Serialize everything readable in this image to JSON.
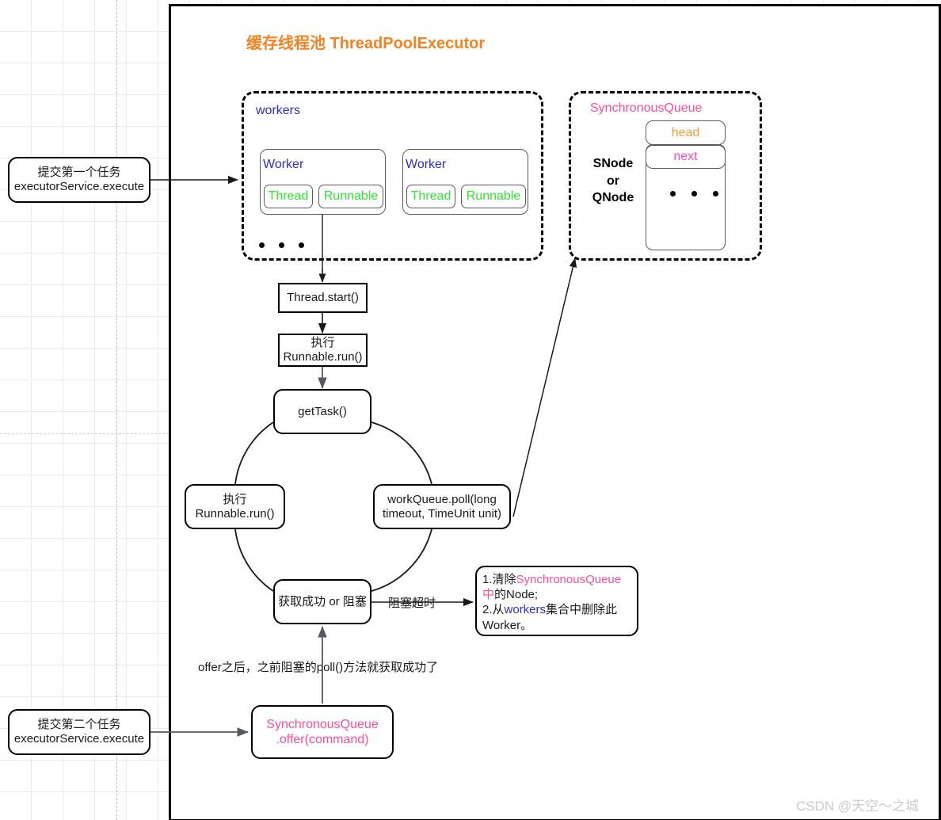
{
  "title": "缓存线程池 ThreadPoolExecutor",
  "colors": {
    "title_orange": "#f58220",
    "blue": "#2b2bd6",
    "green": "#31e531",
    "pink": "#ff4d94",
    "magenta": "#ff44cc",
    "orange": "#ff9a3c",
    "black": "#000000",
    "grid": "#e9ecef",
    "watermark": "#c9cbcd"
  },
  "workers_group": {
    "label": "workers",
    "worker_a": {
      "label": "Worker",
      "thread": "Thread",
      "runnable": "Runnable"
    },
    "worker_b": {
      "label": "Worker",
      "thread": "Thread",
      "runnable": "Runnable"
    },
    "ellipsis": "• • •"
  },
  "queue_group": {
    "label": "SynchronousQueue",
    "node_kind": "SNode\nor\nQNode",
    "node_kind_lines": [
      "SNode",
      "or",
      "QNode"
    ],
    "head": "head",
    "next": "next",
    "ellipsis": "• • •"
  },
  "inputs": {
    "first": {
      "line1": "提交第一个任务",
      "line2": "executorService.execute"
    },
    "second": {
      "line1": "提交第二个任务",
      "line2": "executorService.execute"
    }
  },
  "flow": {
    "thread_start": "Thread.start()",
    "run_top": {
      "line1": "执行",
      "line2": "Runnable.run()"
    },
    "get_task": "getTask()",
    "run_left": {
      "line1": "执行",
      "line2": "Runnable.run()"
    },
    "work_queue_poll": {
      "line1": "workQueue.poll(long",
      "line2": "timeout, TimeUnit unit)"
    },
    "acquire_or_block": "获取成功 or 阻塞",
    "timeout_label": "阻塞超时",
    "offer_note": "offer之后，之前阻塞的poll()方法就获取成功了",
    "offer_box": {
      "line1": "SynchronousQueue",
      "line2": ".offer(command)"
    }
  },
  "cleanup_note": {
    "item1_prefix": "1.清除",
    "item1_highlight": "SynchronousQueue中",
    "item1_suffix": "的Node;",
    "item2_prefix": "2.从",
    "item2_highlight": "workers",
    "item2_suffix": "集合中删除此Worker。"
  },
  "watermark": "CSDN @天空～之城"
}
